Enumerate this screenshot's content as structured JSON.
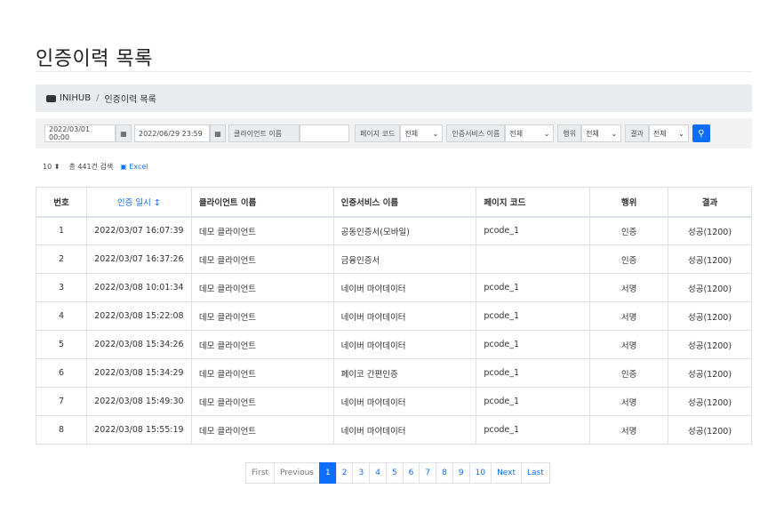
{
  "page": {
    "title": "인증이력 목록"
  },
  "breadcrumb": {
    "home": "INIHUB",
    "separator": "/",
    "current": "인증이력 목록"
  },
  "filters": {
    "start_date": "2022/03/01 00:00",
    "end_date": "2022/06/29 23:59",
    "client_label": "클라이언트 이름",
    "client_value": "",
    "page_code_label": "페이지 코드",
    "page_code_value": "전체",
    "service_label": "인증서비스 이름",
    "service_value": "전체",
    "action_label": "행위",
    "action_value": "전체",
    "result_label": "결과",
    "result_value": "전체"
  },
  "toolbar": {
    "page_size": "10",
    "total": "총 441건 검색",
    "excel": "Excel"
  },
  "table": {
    "headers": [
      "번호",
      "인증 일시 ↕",
      "클라이언트 이름",
      "인증서비스 이름",
      "페이지 코드",
      "행위",
      "결과"
    ],
    "rows": [
      [
        "1",
        "2022/03/07 16:07:39",
        "데모 클라이언트",
        "공동인증서(모바일)",
        "pcode_1",
        "인증",
        "성공(1200)"
      ],
      [
        "2",
        "2022/03/07 16:37:26",
        "데모 클라이언트",
        "금융인증서",
        "",
        "인증",
        "성공(1200)"
      ],
      [
        "3",
        "2022/03/08 10:01:34",
        "데모 클라이언트",
        "네이버 마이데이터",
        "pcode_1",
        "서명",
        "성공(1200)"
      ],
      [
        "4",
        "2022/03/08 15:22:08",
        "데모 클라이언트",
        "네이버 마이데이터",
        "pcode_1",
        "서명",
        "성공(1200)"
      ],
      [
        "5",
        "2022/03/08 15:34:26",
        "데모 클라이언트",
        "네이버 마이데이터",
        "pcode_1",
        "서명",
        "성공(1200)"
      ],
      [
        "6",
        "2022/03/08 15:34:29",
        "데모 클라이언트",
        "페이코 간편인증",
        "pcode_1",
        "인증",
        "성공(1200)"
      ],
      [
        "7",
        "2022/03/08 15:49:30",
        "데모 클라이언트",
        "네이버 마이데이터",
        "pcode_1",
        "서명",
        "성공(1200)"
      ],
      [
        "8",
        "2022/03/08 15:55:19",
        "데모 클라이언트",
        "네이버 마이데이터",
        "pcode_1",
        "서명",
        "성공(1200)"
      ]
    ]
  },
  "pagination": {
    "first": "First",
    "previous": "Previous",
    "pages": [
      "1",
      "2",
      "3",
      "4",
      "5",
      "6",
      "7",
      "8",
      "9",
      "10"
    ],
    "next": "Next",
    "last": "Last",
    "current": "1"
  },
  "colors": {
    "accent": "#0d6efd",
    "breadcrumb_bg": "#e9ecef"
  },
  "icons": {
    "breadcrumb": "book-icon",
    "calendar": "calendar-icon",
    "search": "search-icon",
    "excel": "excel-icon"
  }
}
